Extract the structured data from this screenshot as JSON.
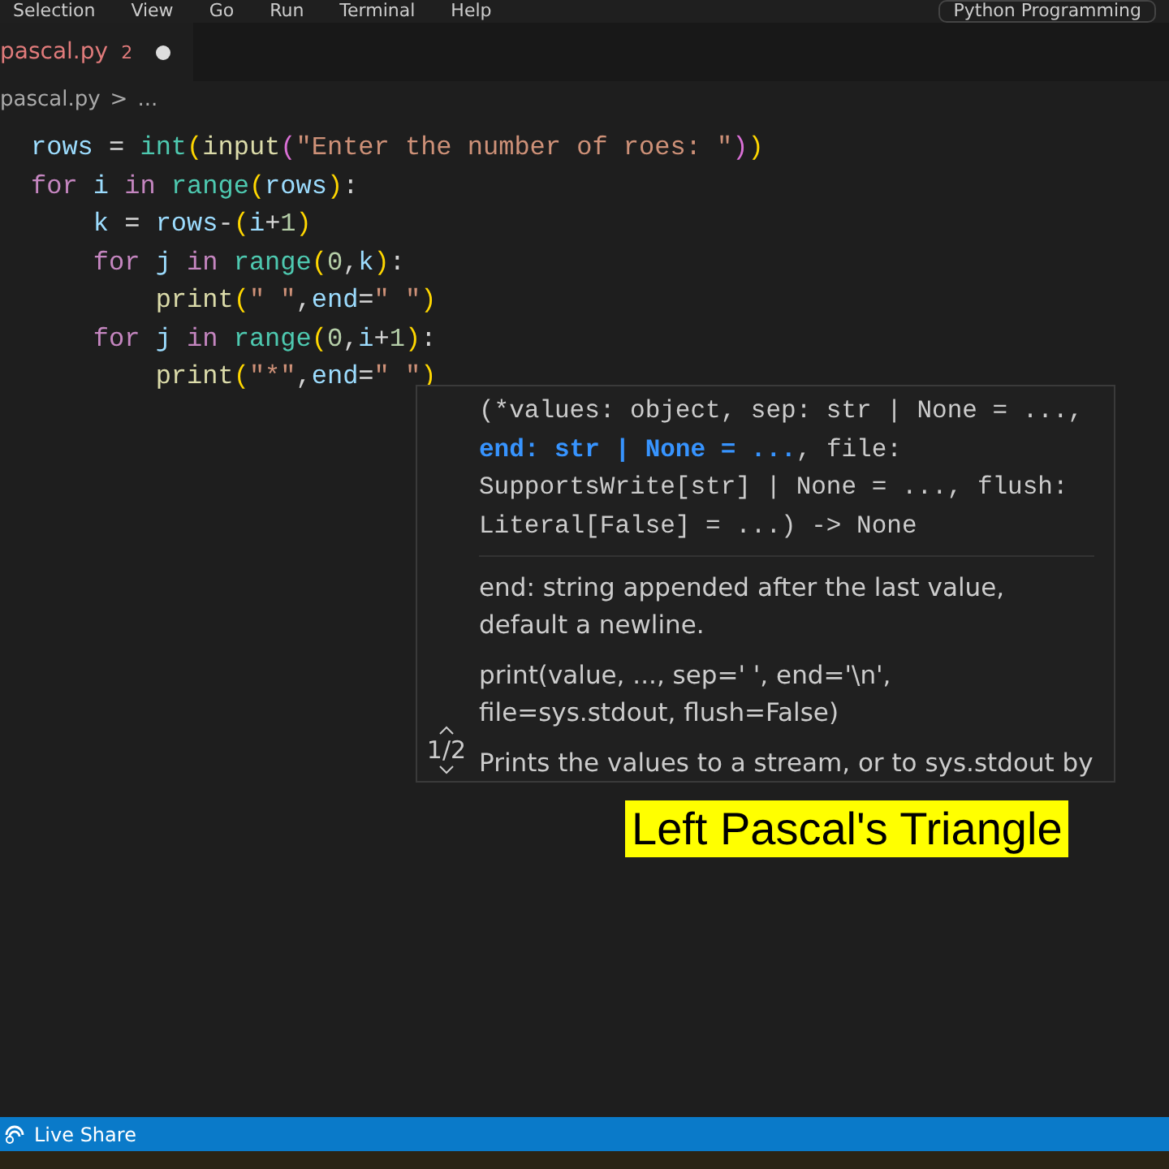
{
  "menu_bar": {
    "items": [
      "Selection",
      "View",
      "Go",
      "Run",
      "Terminal",
      "Help"
    ],
    "search": "Python Programming"
  },
  "tabs": [
    {
      "label": "pascal.py",
      "problems": "2",
      "modified": true,
      "selected": true
    }
  ],
  "breadcrumb": {
    "file": "pascal.py",
    "separator": ">",
    "rest": "..."
  },
  "code_lines": [
    [
      {
        "kind": "var",
        "t": "rows"
      },
      {
        "kind": "op",
        "t": " = "
      },
      {
        "kind": "fn",
        "t": "int"
      },
      {
        "kind": "b1",
        "t": "("
      },
      {
        "kind": "plain",
        "t": "input"
      },
      {
        "kind": "b2",
        "t": "("
      },
      {
        "kind": "str",
        "t": "\"Enter the number of roes: \""
      },
      {
        "kind": "b2",
        "t": ")"
      },
      {
        "kind": "b1",
        "t": ")"
      }
    ],
    [
      {
        "kind": "kw",
        "t": "for"
      },
      {
        "kind": "var",
        "t": " i "
      },
      {
        "kind": "kw",
        "t": "in"
      },
      {
        "kind": "fn",
        "t": " range"
      },
      {
        "kind": "b1",
        "t": "("
      },
      {
        "kind": "var",
        "t": "rows"
      },
      {
        "kind": "b1",
        "t": ")"
      },
      {
        "kind": "op",
        "t": ":"
      }
    ],
    [
      {
        "kind": "var",
        "t": "    k"
      },
      {
        "kind": "op",
        "t": " = "
      },
      {
        "kind": "var",
        "t": "rows"
      },
      {
        "kind": "op",
        "t": "-"
      },
      {
        "kind": "b1",
        "t": "("
      },
      {
        "kind": "var",
        "t": "i"
      },
      {
        "kind": "op",
        "t": "+"
      },
      {
        "kind": "num",
        "t": "1"
      },
      {
        "kind": "b1",
        "t": ")"
      }
    ],
    [
      {
        "kind": "kw",
        "t": "    for"
      },
      {
        "kind": "var",
        "t": " j "
      },
      {
        "kind": "kw",
        "t": "in"
      },
      {
        "kind": "fn",
        "t": " range"
      },
      {
        "kind": "b1",
        "t": "("
      },
      {
        "kind": "num",
        "t": "0"
      },
      {
        "kind": "op",
        "t": ","
      },
      {
        "kind": "var",
        "t": "k"
      },
      {
        "kind": "b1",
        "t": ")"
      },
      {
        "kind": "op",
        "t": ":"
      }
    ],
    [
      {
        "kind": "plain",
        "t": "        print"
      },
      {
        "kind": "b1",
        "t": "("
      },
      {
        "kind": "str",
        "t": "\" \""
      },
      {
        "kind": "op",
        "t": ","
      },
      {
        "kind": "var",
        "t": "end"
      },
      {
        "kind": "op",
        "t": "="
      },
      {
        "kind": "str",
        "t": "\" \""
      },
      {
        "kind": "b1",
        "t": ")"
      }
    ],
    [
      {
        "kind": "kw",
        "t": "    for"
      },
      {
        "kind": "var",
        "t": " j "
      },
      {
        "kind": "kw",
        "t": "in"
      },
      {
        "kind": "fn",
        "t": " range"
      },
      {
        "kind": "b1",
        "t": "("
      },
      {
        "kind": "num",
        "t": "0"
      },
      {
        "kind": "op",
        "t": ","
      },
      {
        "kind": "var",
        "t": "i"
      },
      {
        "kind": "op",
        "t": "+"
      },
      {
        "kind": "num",
        "t": "1"
      },
      {
        "kind": "b1",
        "t": ")"
      },
      {
        "kind": "op",
        "t": ":"
      }
    ],
    [
      {
        "kind": "plain",
        "t": "        print"
      },
      {
        "kind": "b1",
        "t": "("
      },
      {
        "kind": "str",
        "t": "\"*\""
      },
      {
        "kind": "op",
        "t": ","
      },
      {
        "kind": "var",
        "t": "end"
      },
      {
        "kind": "op",
        "t": "="
      },
      {
        "kind": "str",
        "t": "\" \""
      },
      {
        "kind": "b1",
        "t": ")"
      }
    ]
  ],
  "signature_help": {
    "counter": "1/2",
    "signature": [
      {
        "t": "(*values: object, sep: str | None = ...,",
        "active": false
      },
      {
        "t": "end: str | None = ...",
        "active": true
      },
      {
        "t": ", file: SupportsWrite[str] | None = ..., flush: Literal[False] = ...) -> None",
        "active": false
      }
    ],
    "param_doc": "end:  string appended after the last value, default a newline.",
    "doc": [
      "print(value, ..., sep=' ', end='\\n', file=sys.stdout, flush=False)",
      "Prints the values to a stream, or to sys.stdout by"
    ]
  },
  "caption": "Left Pascal's Triangle",
  "status_bar": {
    "items": [
      "Live Share"
    ]
  }
}
